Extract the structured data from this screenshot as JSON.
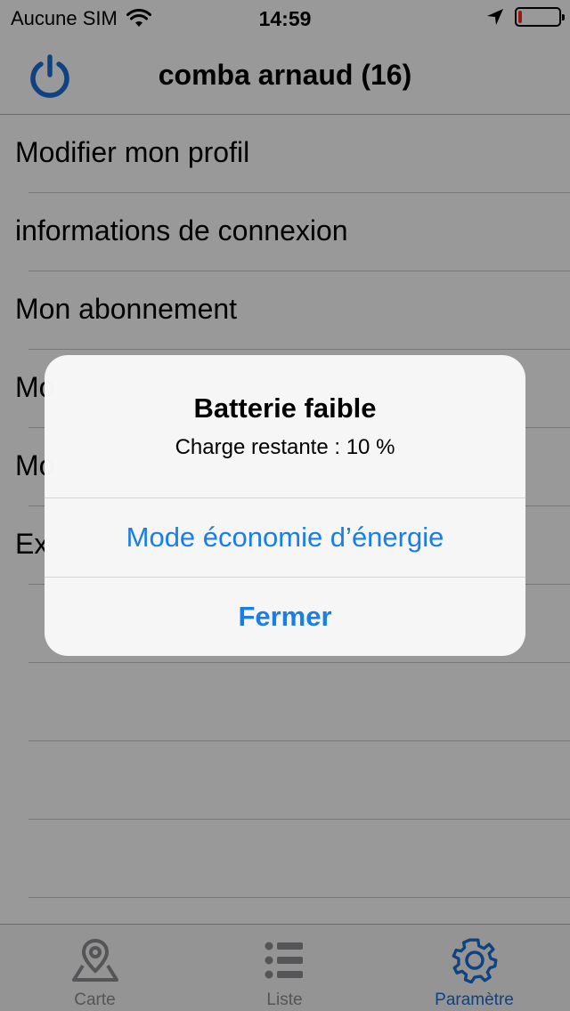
{
  "status_bar": {
    "carrier": "Aucune SIM",
    "time": "14:59",
    "wifi_icon": "wifi-icon",
    "location_icon": "location-arrow-icon",
    "battery_level": 0.1,
    "battery_color": "#ff2a2a"
  },
  "nav": {
    "title": "comba arnaud (16)",
    "power_icon": "power-icon",
    "accent": "#1a6fd8"
  },
  "menu": {
    "items": [
      {
        "label": "Modifier mon profil"
      },
      {
        "label": "informations de connexion"
      },
      {
        "label": "Mon abonnement"
      },
      {
        "label": "Mo"
      },
      {
        "label": "Mo"
      },
      {
        "label": "Ex"
      },
      {
        "label": ""
      },
      {
        "label": ""
      },
      {
        "label": ""
      },
      {
        "label": ""
      }
    ]
  },
  "tabs": [
    {
      "label": "Carte",
      "icon": "map-pin-icon",
      "active": false
    },
    {
      "label": "Liste",
      "icon": "list-icon",
      "active": false
    },
    {
      "label": "Paramètre",
      "icon": "gear-icon",
      "active": true
    }
  ],
  "alert": {
    "title": "Batterie faible",
    "message": "Charge restante : 10 %",
    "primary_button": "Mode économie d’énergie",
    "close_button": "Fermer",
    "button_color": "#1a7ee8"
  }
}
